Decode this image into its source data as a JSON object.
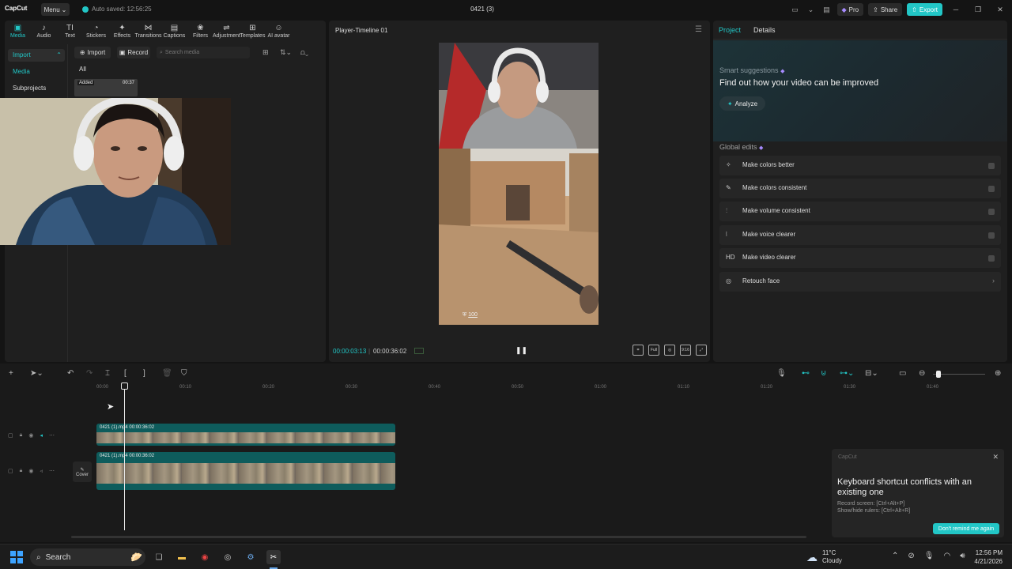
{
  "titlebar": {
    "logo": "CapCut",
    "menu_label": "Menu",
    "autosave": "Auto saved: 12:56:25",
    "doc_title": "0421 (3)",
    "pro_label": "Pro",
    "share_label": "Share",
    "export_label": "Export"
  },
  "toolbar": {
    "items": [
      {
        "label": "Media",
        "icon": "▣"
      },
      {
        "label": "Audio",
        "icon": "♪"
      },
      {
        "label": "Text",
        "icon": "TI"
      },
      {
        "label": "Stickers",
        "icon": "◔"
      },
      {
        "label": "Effects",
        "icon": "✦"
      },
      {
        "label": "Transitions",
        "icon": "⋈"
      },
      {
        "label": "Captions",
        "icon": "▤"
      },
      {
        "label": "Filters",
        "icon": "❀"
      },
      {
        "label": "Adjustment",
        "icon": "⇌"
      },
      {
        "label": "Templates",
        "icon": "⊞"
      },
      {
        "label": "AI avatar",
        "icon": "☺"
      }
    ]
  },
  "side_nav": {
    "import": "Import",
    "media": "Media",
    "subprojects": "Subprojects"
  },
  "media": {
    "import_btn": "Import",
    "record_btn": "Record",
    "search_placeholder": "Search media",
    "tab_all": "All",
    "thumb_added": "Added",
    "thumb_duration": "00:37"
  },
  "player": {
    "title": "Player-Timeline 01",
    "current_time": "00:00:03:13",
    "total_time": "00:00:36:02",
    "hud_value": "100"
  },
  "right_panel": {
    "tab_project": "Project",
    "tab_details": "Details",
    "smart_title": "Smart suggestions",
    "smart_sub": "Find out how your video can be improved",
    "analyze": "Analyze",
    "global_title": "Global edits",
    "global_edits": [
      {
        "label": "Make colors better",
        "icon": "✧"
      },
      {
        "label": "Make colors consistent",
        "icon": "✎"
      },
      {
        "label": "Make volume consistent",
        "icon": "⫶"
      },
      {
        "label": "Make voice clearer",
        "icon": "⦚"
      },
      {
        "label": "Make video clearer",
        "icon": "HD"
      },
      {
        "label": "Retouch face",
        "icon": "◎"
      }
    ]
  },
  "timeline": {
    "ticks": [
      "00:00",
      "00:10",
      "00:20",
      "00:30",
      "00:40",
      "00:50",
      "01:00",
      "01:10",
      "01:20",
      "01:30",
      "01:40"
    ],
    "clip1_label": "0421 (1).mp4   00:00:36:02",
    "clip2_label": "0421 (1).mp4   00:00:36:02",
    "cover_label": "Cover"
  },
  "toast": {
    "app": "CapCut",
    "title": "Keyboard shortcut conflicts with an existing one",
    "line1": "Record screen: [Ctrl+Alt+P]",
    "line2": "Show/hide rulers: [Ctrl+Alt+R]",
    "button": "Don't remind me again"
  },
  "taskbar": {
    "search": "Search",
    "temp": "11°C",
    "weather": "Cloudy",
    "time": "12:56 PM",
    "date": "4/21/2026"
  },
  "colors": {
    "accent": "#22c6c6",
    "bg": "#141414",
    "panel": "#1f1f1f"
  }
}
